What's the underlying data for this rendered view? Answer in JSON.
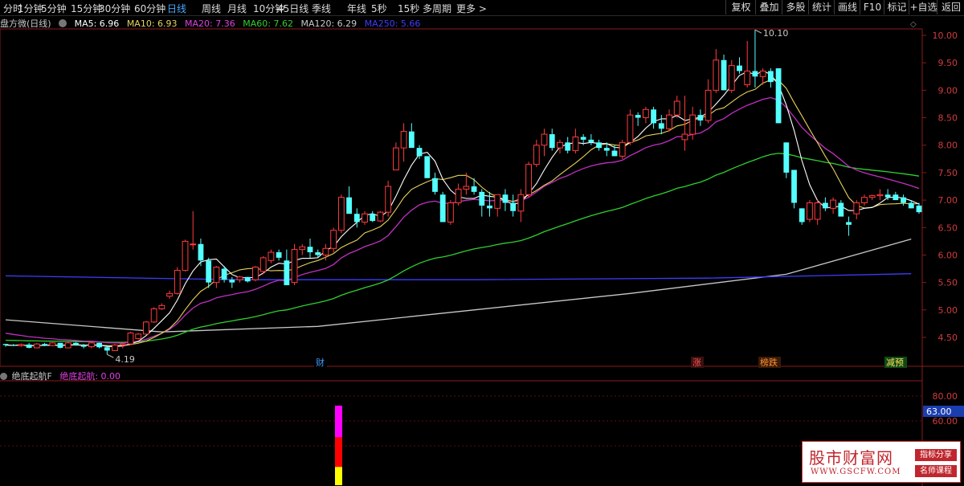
{
  "toolbar": {
    "periods": [
      "分时",
      "1分钟",
      "5分钟",
      "15分钟",
      "30分钟",
      "60分钟",
      "日线",
      "周线",
      "月线",
      "10分钟",
      "45日线",
      "季线",
      "年线",
      "5秒",
      "15秒",
      "多周期",
      "更多 >"
    ],
    "active_period": "日线",
    "right_buttons": [
      "复权",
      "叠加",
      "多股",
      "统计",
      "画线",
      "F10",
      "标记",
      "+自选",
      "返回"
    ]
  },
  "legend": {
    "title": "盘方微(日线)",
    "items": [
      {
        "label": "MA5: 6.96",
        "color": "#ffffff"
      },
      {
        "label": "MA10: 6.93",
        "color": "#e6d35a"
      },
      {
        "label": "MA20: 7.36",
        "color": "#e040e0"
      },
      {
        "label": "MA60: 7.62",
        "color": "#2fd02f"
      },
      {
        "label": "MA120: 6.29",
        "color": "#c8c8c8"
      },
      {
        "label": "MA250: 5.66",
        "color": "#3d3dff"
      }
    ]
  },
  "price_axis": [
    "10.00",
    "9.50",
    "9.00",
    "8.50",
    "8.00",
    "7.50",
    "7.00",
    "6.50",
    "6.00",
    "5.50",
    "5.00",
    "4.50"
  ],
  "annotations": {
    "high": "10.10",
    "low": "4.19"
  },
  "event_markers": [
    {
      "label": "财",
      "color": "#3d9bff",
      "bg": "#000000"
    },
    {
      "label": "涨",
      "color": "#ff5050",
      "bg": "#3a1010"
    },
    {
      "label": "榜跌",
      "color": "#ff9030",
      "bg": "#3a1a08"
    },
    {
      "label": "减预",
      "color": "#ffe060",
      "bg": "#0e4a14"
    }
  ],
  "indicator": {
    "name": "绝底起航F",
    "value_label": "绝底起航: 0.00",
    "axis": [
      "80.00",
      "60.00"
    ],
    "current_tag": "63.00"
  },
  "watermark": {
    "title": "股市财富网",
    "url": "WWW.GSCFW.COM",
    "tag1": "指标分享",
    "tag2": "名师课程"
  },
  "chart_data": {
    "type": "candlestick",
    "colors": {
      "up": "#ff3c3c",
      "down": "#54ffff"
    },
    "candles": [
      [
        4.38,
        4.38,
        4.33,
        4.36
      ],
      [
        4.36,
        4.38,
        4.34,
        4.35
      ],
      [
        4.35,
        4.39,
        4.33,
        4.37
      ],
      [
        4.37,
        4.4,
        4.3,
        4.31
      ],
      [
        4.31,
        4.4,
        4.3,
        4.38
      ],
      [
        4.38,
        4.4,
        4.34,
        4.35
      ],
      [
        4.35,
        4.41,
        4.34,
        4.4
      ],
      [
        4.4,
        4.4,
        4.3,
        4.31
      ],
      [
        4.31,
        4.42,
        4.3,
        4.4
      ],
      [
        4.4,
        4.41,
        4.35,
        4.36
      ],
      [
        4.36,
        4.38,
        4.3,
        4.33
      ],
      [
        4.33,
        4.42,
        4.3,
        4.4
      ],
      [
        4.4,
        4.4,
        4.3,
        4.32
      ],
      [
        4.32,
        4.36,
        4.19,
        4.26
      ],
      [
        4.26,
        4.38,
        4.25,
        4.36
      ],
      [
        4.36,
        4.4,
        4.3,
        4.38
      ],
      [
        4.38,
        4.6,
        4.36,
        4.58
      ],
      [
        4.48,
        4.58,
        4.46,
        4.56
      ],
      [
        4.56,
        4.8,
        4.56,
        4.78
      ],
      [
        4.78,
        5.05,
        4.76,
        5.02
      ],
      [
        5.02,
        5.12,
        5.0,
        5.08
      ],
      [
        5.25,
        5.35,
        5.2,
        5.3
      ],
      [
        5.3,
        5.78,
        5.28,
        5.72
      ],
      [
        5.72,
        6.28,
        5.7,
        6.25
      ],
      [
        6.2,
        6.8,
        6.1,
        6.2
      ],
      [
        6.2,
        6.3,
        5.8,
        5.9
      ],
      [
        5.9,
        5.95,
        5.4,
        5.5
      ],
      [
        5.5,
        5.8,
        5.4,
        5.78
      ],
      [
        5.75,
        5.8,
        5.5,
        5.55
      ],
      [
        5.55,
        5.6,
        5.4,
        5.5
      ],
      [
        5.55,
        5.62,
        5.5,
        5.6
      ],
      [
        5.6,
        5.6,
        5.5,
        5.52
      ],
      [
        5.55,
        5.8,
        5.52,
        5.78
      ],
      [
        5.7,
        5.98,
        5.65,
        5.95
      ],
      [
        5.9,
        6.1,
        5.85,
        6.05
      ],
      [
        6.05,
        6.1,
        5.9,
        5.95
      ],
      [
        5.9,
        6.1,
        5.5,
        5.45
      ],
      [
        5.5,
        6.2,
        5.45,
        6.1
      ],
      [
        6.1,
        6.2,
        6.0,
        6.15
      ],
      [
        6.15,
        6.3,
        5.95,
        6.05
      ],
      [
        6.05,
        6.1,
        5.95,
        6.0
      ],
      [
        6.0,
        6.2,
        5.9,
        6.12
      ],
      [
        6.12,
        6.5,
        6.05,
        6.45
      ],
      [
        6.45,
        7.1,
        6.4,
        7.05
      ],
      [
        7.05,
        7.25,
        6.8,
        6.75
      ],
      [
        6.75,
        6.85,
        6.5,
        6.6
      ],
      [
        6.6,
        6.8,
        6.55,
        6.75
      ],
      [
        6.75,
        6.8,
        6.6,
        6.62
      ],
      [
        6.62,
        6.8,
        6.6,
        6.78
      ],
      [
        6.78,
        7.35,
        6.7,
        7.25
      ],
      [
        7.55,
        8.05,
        7.55,
        7.95
      ],
      [
        7.95,
        8.4,
        7.7,
        8.25
      ],
      [
        8.25,
        8.4,
        8.0,
        7.95
      ],
      [
        7.95,
        8.0,
        7.75,
        7.8
      ],
      [
        7.8,
        7.8,
        7.4,
        7.4
      ],
      [
        7.4,
        7.5,
        7.1,
        7.15
      ],
      [
        7.1,
        7.15,
        6.7,
        6.6
      ],
      [
        6.6,
        7.0,
        6.55,
        6.95
      ],
      [
        6.95,
        7.3,
        6.9,
        7.2
      ],
      [
        7.2,
        7.5,
        7.1,
        7.25
      ],
      [
        7.25,
        7.4,
        7.1,
        7.15
      ],
      [
        7.15,
        7.2,
        6.7,
        6.9
      ],
      [
        6.9,
        7.15,
        6.7,
        6.85
      ],
      [
        6.85,
        7.1,
        6.7,
        7.1
      ],
      [
        7.1,
        7.2,
        6.8,
        6.95
      ],
      [
        6.95,
        7.1,
        6.7,
        6.8
      ],
      [
        6.8,
        7.2,
        6.6,
        7.1
      ],
      [
        7.1,
        7.7,
        7.05,
        7.65
      ],
      [
        7.65,
        8.1,
        7.6,
        8.0
      ],
      [
        8.0,
        8.3,
        7.8,
        8.2
      ],
      [
        8.2,
        8.3,
        7.9,
        7.95
      ],
      [
        7.95,
        8.1,
        7.85,
        8.05
      ],
      [
        8.05,
        8.15,
        7.85,
        7.9
      ],
      [
        7.9,
        8.3,
        7.85,
        8.15
      ],
      [
        8.15,
        8.2,
        8.0,
        8.1
      ],
      [
        8.1,
        8.2,
        8.0,
        8.05
      ],
      [
        8.05,
        8.1,
        7.9,
        7.95
      ],
      [
        7.95,
        8.05,
        7.8,
        7.9
      ],
      [
        7.9,
        8.0,
        7.8,
        7.8
      ],
      [
        7.8,
        8.1,
        7.75,
        8.05
      ],
      [
        8.05,
        8.65,
        8.0,
        8.55
      ],
      [
        8.55,
        8.6,
        8.35,
        8.5
      ],
      [
        8.5,
        8.7,
        8.4,
        8.65
      ],
      [
        8.65,
        8.7,
        8.3,
        8.4
      ],
      [
        8.4,
        8.55,
        8.2,
        8.3
      ],
      [
        8.3,
        8.65,
        8.25,
        8.55
      ],
      [
        8.55,
        8.9,
        8.5,
        8.8
      ],
      [
        8.1,
        8.9,
        7.9,
        8.2
      ],
      [
        8.2,
        8.7,
        8.1,
        8.55
      ],
      [
        8.55,
        8.65,
        8.35,
        8.45
      ],
      [
        8.45,
        9.2,
        8.4,
        9.0
      ],
      [
        9.0,
        9.75,
        8.95,
        9.55
      ],
      [
        9.55,
        9.65,
        9.0,
        9.0
      ],
      [
        9.0,
        9.55,
        8.95,
        9.45
      ],
      [
        9.45,
        9.6,
        9.3,
        9.35
      ],
      [
        9.1,
        9.9,
        9.05,
        9.35
      ],
      [
        9.35,
        10.1,
        9.05,
        9.25
      ],
      [
        9.25,
        9.4,
        9.1,
        9.35
      ],
      [
        9.35,
        9.4,
        9.05,
        9.15
      ],
      [
        9.4,
        9.4,
        8.4,
        8.4
      ],
      [
        8.05,
        8.05,
        7.4,
        7.5
      ],
      [
        7.55,
        7.55,
        6.85,
        6.95
      ],
      [
        6.85,
        6.85,
        6.55,
        6.6
      ],
      [
        6.65,
        7.0,
        6.6,
        6.95
      ],
      [
        6.65,
        7.0,
        6.55,
        6.95
      ],
      [
        6.95,
        7.05,
        6.8,
        6.85
      ],
      [
        6.85,
        7.05,
        6.75,
        7.0
      ],
      [
        6.95,
        7.0,
        6.8,
        6.7
      ],
      [
        6.6,
        6.7,
        6.35,
        6.55
      ],
      [
        6.75,
        7.0,
        6.65,
        6.95
      ],
      [
        6.95,
        7.1,
        6.9,
        7.05
      ],
      [
        7.05,
        7.1,
        7.0,
        7.08
      ],
      [
        7.08,
        7.2,
        7.0,
        7.1
      ],
      [
        7.1,
        7.2,
        7.0,
        7.05
      ],
      [
        7.1,
        7.15,
        7.0,
        7.0
      ],
      [
        7.05,
        7.1,
        6.9,
        6.95
      ],
      [
        6.95,
        7.0,
        6.85,
        6.85
      ],
      [
        6.9,
        6.95,
        6.75,
        6.78
      ]
    ],
    "ma_series": [
      {
        "name": "MA120",
        "color": "#c8c8c8",
        "points": [
          [
            0,
            4.82
          ],
          [
            20,
            4.6
          ],
          [
            40,
            4.7
          ],
          [
            60,
            5.0
          ],
          [
            80,
            5.3
          ],
          [
            100,
            5.65
          ],
          [
            116,
            6.29
          ]
        ]
      },
      {
        "name": "MA250",
        "color": "#3d3dff",
        "points": [
          [
            0,
            5.62
          ],
          [
            30,
            5.55
          ],
          [
            60,
            5.55
          ],
          [
            90,
            5.58
          ],
          [
            116,
            5.66
          ]
        ]
      }
    ],
    "indicator_bars": [
      {
        "bottom": 0,
        "top": 0.18,
        "color": "#ffff00"
      },
      {
        "bottom": 0.18,
        "top": 0.47,
        "color": "#ff0000"
      },
      {
        "bottom": 0.47,
        "top": 0.78,
        "color": "#ff00ff"
      }
    ]
  }
}
